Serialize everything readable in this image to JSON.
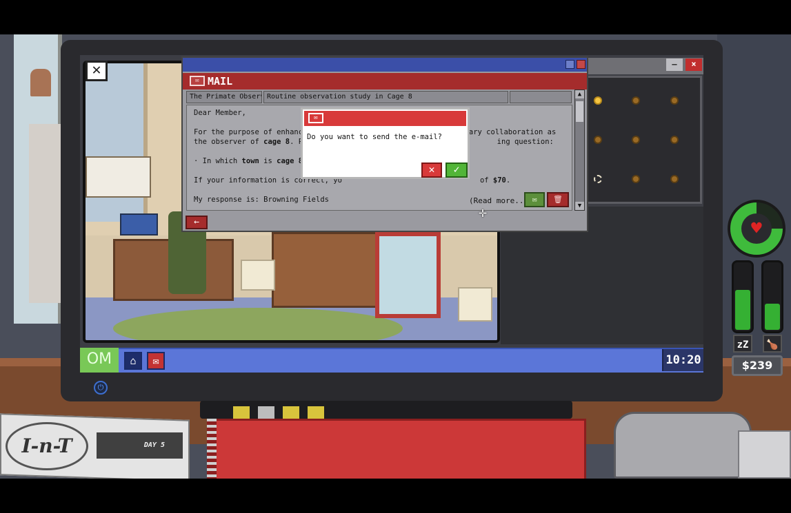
{
  "window": {
    "cam_close_label": "✕"
  },
  "mail": {
    "title": "MAIL",
    "tabs": [
      "The Primate Observa...",
      "Routine observation study in Cage 8",
      ""
    ],
    "greeting": "Dear Member,",
    "para1_part1": "For the purpose of enhancing ou",
    "para1_part2": "voluntary collaboration as",
    "para1_part3": "the observer of ",
    "para1_bold": "cage 8",
    "para1_part4": ". Please",
    "para1_part5": "ing question:",
    "question_prefix": "· In which ",
    "question_bold1": "town",
    "question_mid": " is ",
    "question_bold2": "cage 8",
    "question_suffix": " locate",
    "reward_prefix": "If your information is correct, yo",
    "reward_suffix": "of ",
    "reward_amount": "$70",
    "reward_end": ".",
    "response_label": "My response is: Browning Fields",
    "read_more": "(Read more...)",
    "back_label": "←"
  },
  "dialog": {
    "question": "Do you want to send the e-mail?",
    "cancel_label": "✕",
    "confirm_label": "✓"
  },
  "taskbar": {
    "os_label": "OM",
    "clock": "10:20"
  },
  "hud": {
    "money": "$239",
    "health_fraction": 0.75,
    "sleep_level": 0.6,
    "food_level": 0.4
  },
  "newspaper": {
    "logo": "I-n-T",
    "day_label": "DAY 5"
  },
  "grid": {
    "dots": [
      "lit",
      "normal",
      "normal",
      "normal",
      "normal",
      "normal",
      "ring",
      "normal",
      "normal"
    ]
  },
  "colors": {
    "mail_red": "#a52c2c",
    "taskbar_blue": "#5b76d8",
    "health_green": "#3fbb3c"
  }
}
